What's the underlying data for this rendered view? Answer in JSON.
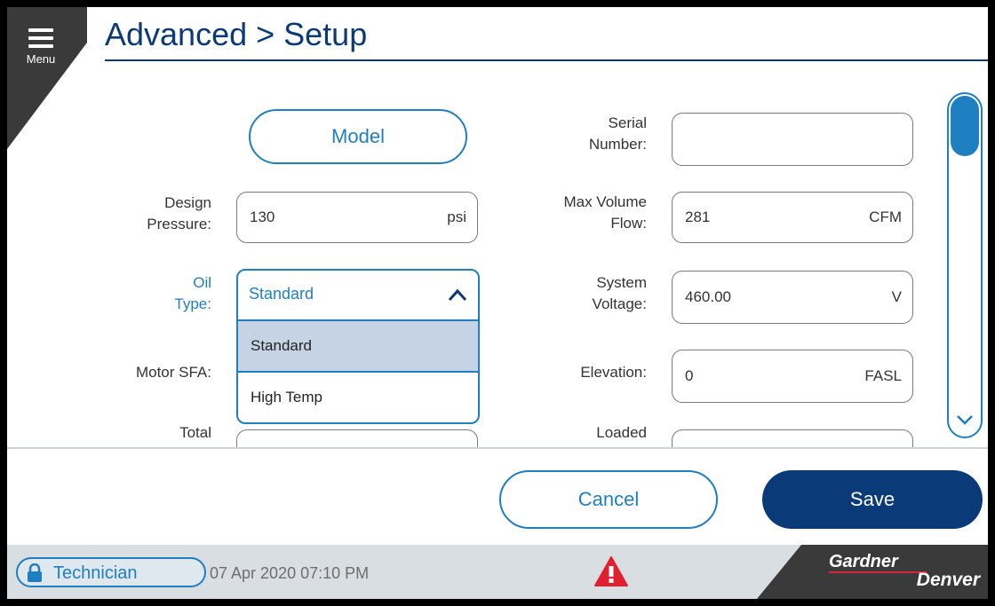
{
  "header": {
    "menu_label": "Menu",
    "title": "Advanced > Setup"
  },
  "colors": {
    "accent": "#1e7fc1",
    "primary": "#0b3a78",
    "alarm": "#e02030",
    "selected": "#c5d3e4"
  },
  "form": {
    "model_button": "Model",
    "left": [
      {
        "label": [
          "Design",
          "Pressure:"
        ],
        "value": "130",
        "unit": "psi"
      },
      {
        "label": [
          "Oil",
          "Type:"
        ]
      },
      {
        "label": [
          "Motor SFA:"
        ]
      },
      {
        "label": [
          "Total"
        ]
      }
    ],
    "right": [
      {
        "label": [
          "Serial",
          "Number:"
        ],
        "value": "",
        "unit": ""
      },
      {
        "label": [
          "Max Volume",
          "Flow:"
        ],
        "value": "281",
        "unit": "CFM"
      },
      {
        "label": [
          "System",
          "Voltage:"
        ],
        "value": "460.00",
        "unit": "V"
      },
      {
        "label": [
          "Elevation:"
        ],
        "value": "0",
        "unit": "FASL"
      },
      {
        "label": [
          "Loaded"
        ]
      }
    ],
    "oil_type_dropdown": {
      "selected": "Standard",
      "options": [
        "Standard",
        "High Temp"
      ],
      "icon": "chevron-up-icon"
    }
  },
  "actions": {
    "cancel": "Cancel",
    "save": "Save"
  },
  "footer": {
    "user_role": "Technician",
    "datetime": "07 Apr 2020  07:10 PM",
    "brand_top": "Gardner",
    "brand_bottom": "Denver",
    "alarm_icon": "warning-icon"
  }
}
